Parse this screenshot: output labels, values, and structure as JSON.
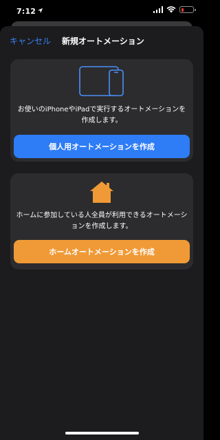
{
  "status_bar": {
    "time": "7:12",
    "battery_color": "#ff3b30"
  },
  "nav": {
    "cancel_label": "キャンセル",
    "title": "新規オートメーション"
  },
  "personal_card": {
    "icon": "iphone-ipad-icon",
    "description": "お使いのiPhoneやiPadで実行するオートメーションを作成します。",
    "button_label": "個人用オートメーションを作成",
    "button_color": "#2e7cf6"
  },
  "home_card": {
    "icon": "house-icon",
    "description": "ホームに参加している人全員が利用できるオートメーションを作成します。",
    "button_label": "ホームオートメーションを作成",
    "button_color": "#f09a37"
  },
  "colors": {
    "accent_blue": "#3a82f7",
    "sheet_bg": "#1c1c1e",
    "card_bg": "#2c2c2e"
  }
}
